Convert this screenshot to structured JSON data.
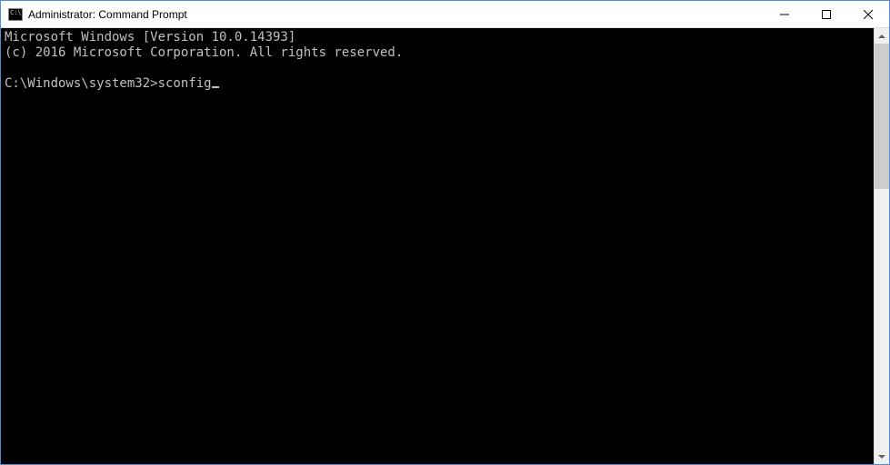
{
  "window": {
    "title": "Administrator: Command Prompt"
  },
  "terminal": {
    "line1": "Microsoft Windows [Version 10.0.14393]",
    "line2": "(c) 2016 Microsoft Corporation. All rights reserved.",
    "blank": "",
    "prompt": "C:\\Windows\\system32>",
    "command": "sconfig"
  },
  "controls": {
    "minimize": "Minimize",
    "maximize": "Maximize",
    "close": "Close"
  }
}
